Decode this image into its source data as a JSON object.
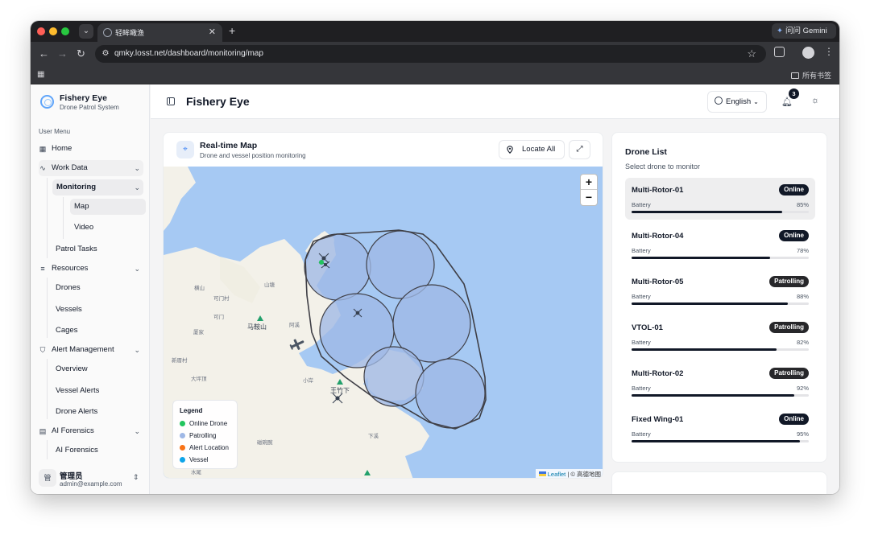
{
  "browser": {
    "tab_title": "轻眸瞰渔",
    "tab_close": "✕",
    "new_tab": "+",
    "gemini_label": "问问 Gemini",
    "url": "qmky.losst.net/dashboard/monitoring/map",
    "bookmarks_all": "所有书签"
  },
  "sidebar": {
    "brand_title": "Fishery Eye",
    "brand_subtitle": "Drone Patrol System",
    "menu_label": "User Menu",
    "home": "Home",
    "work_data": "Work Data",
    "monitoring": "Monitoring",
    "map": "Map",
    "video": "Video",
    "patrol_tasks": "Patrol Tasks",
    "resources": "Resources",
    "drones": "Drones",
    "vessels": "Vessels",
    "cages": "Cages",
    "alert_management": "Alert Management",
    "overview": "Overview",
    "vessel_alerts": "Vessel Alerts",
    "drone_alerts": "Drone Alerts",
    "ai_forensics": "AI Forensics",
    "ai_forensics_sub": "AI Forensics",
    "user_avatar": "管",
    "user_name": "管理员",
    "user_email": "admin@example.com"
  },
  "header": {
    "title": "Fishery Eye",
    "language": "English",
    "notification_count": "3"
  },
  "map_panel": {
    "title": "Real-time Map",
    "subtitle": "Drone and vessel position monitoring",
    "locate_all": "Locate All",
    "zoom_in": "+",
    "zoom_out": "−",
    "attribution_leaflet": "Leaflet",
    "attribution_rest": " | © 高德地图",
    "legend": {
      "title": "Legend",
      "items": [
        {
          "label": "Online Drone",
          "color": "#22c55e"
        },
        {
          "label": "Patrolling",
          "color": "#9fb8e6"
        },
        {
          "label": "Alert Location",
          "color": "#f97316"
        },
        {
          "label": "Vessel",
          "color": "#0ea5e9"
        }
      ]
    },
    "place_labels": [
      "横山",
      "山塘",
      "可门村",
      "可门",
      "马鞍山",
      "阿溪",
      "厦家",
      "新厝村",
      "大坪顶",
      "小岸",
      "王竹下",
      "下溪",
      "磁碗腕",
      "水尾"
    ]
  },
  "drone_list": {
    "title": "Drone List",
    "subtitle": "Select drone to monitor",
    "battery_label": "Battery",
    "drones": [
      {
        "name": "Multi-Rotor-01",
        "status": "Online",
        "battery": 85,
        "battery_text": "85%"
      },
      {
        "name": "Multi-Rotor-04",
        "status": "Online",
        "battery": 78,
        "battery_text": "78%"
      },
      {
        "name": "Multi-Rotor-05",
        "status": "Patrolling",
        "battery": 88,
        "battery_text": "88%"
      },
      {
        "name": "VTOL-01",
        "status": "Patrolling",
        "battery": 82,
        "battery_text": "82%"
      },
      {
        "name": "Multi-Rotor-02",
        "status": "Patrolling",
        "battery": 92,
        "battery_text": "92%"
      },
      {
        "name": "Fixed Wing-01",
        "status": "Online",
        "battery": 95,
        "battery_text": "95%"
      }
    ]
  },
  "colors": {
    "water": "#a6c9f3",
    "land": "#f3f1e9",
    "accent": "#111827",
    "patrol_circle": "#9fb8e6"
  }
}
